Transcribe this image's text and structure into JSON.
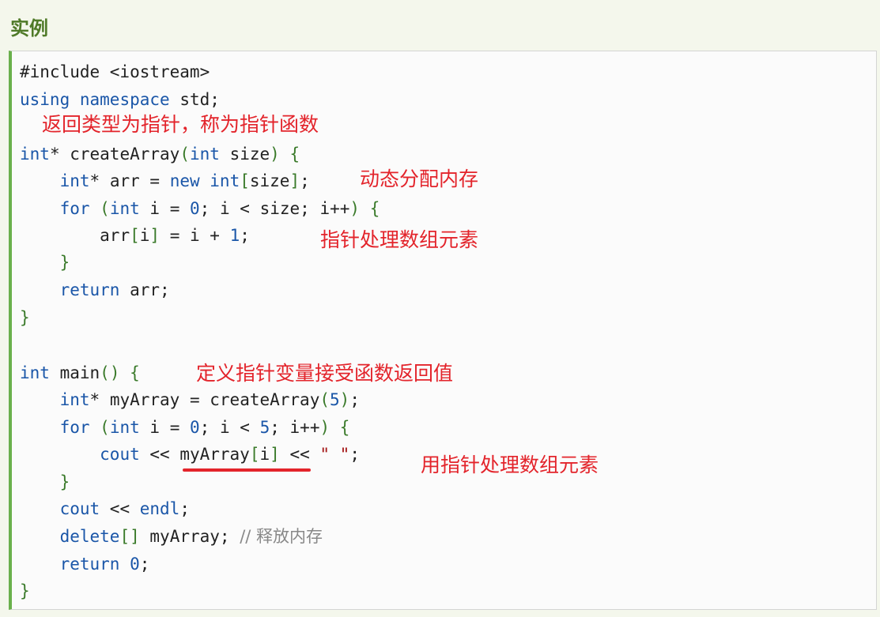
{
  "section": {
    "title": "实例"
  },
  "code": {
    "lines": [
      {
        "text": "#include <iostream>"
      },
      {
        "text": "using namespace std;"
      },
      {
        "text": "int* createArray(int size) {"
      },
      {
        "text": "    int* arr = new int[size];"
      },
      {
        "text": "    for (int i = 0; i < size; i++) {"
      },
      {
        "text": "        arr[i] = i + 1;"
      },
      {
        "text": "    }"
      },
      {
        "text": "    return arr;"
      },
      {
        "text": "}"
      },
      {
        "text": "int main() {"
      },
      {
        "text": "    int* myArray = createArray(5);"
      },
      {
        "text": "    for (int i = 0; i < 5; i++) {"
      },
      {
        "text": "        cout << myArray[i] << \" \";"
      },
      {
        "text": "    }"
      },
      {
        "text": "    cout << endl;"
      },
      {
        "text": "    delete[] myArray; // 释放内存"
      },
      {
        "text": "    return 0;"
      },
      {
        "text": "}"
      }
    ]
  },
  "annotations": {
    "return_pointer": "返回类型为指针，称为指针函数",
    "dynamic_alloc": "动态分配内存",
    "pointer_process_1": "指针处理数组元素",
    "define_pointer": "定义指针变量接受函数返回值",
    "pointer_process_2": "用指针处理数组元素"
  },
  "colors": {
    "title": "#4f7a28",
    "annotation": "#e3242b",
    "keyword": "#1a56a8",
    "accent_border": "#6ab04c"
  }
}
